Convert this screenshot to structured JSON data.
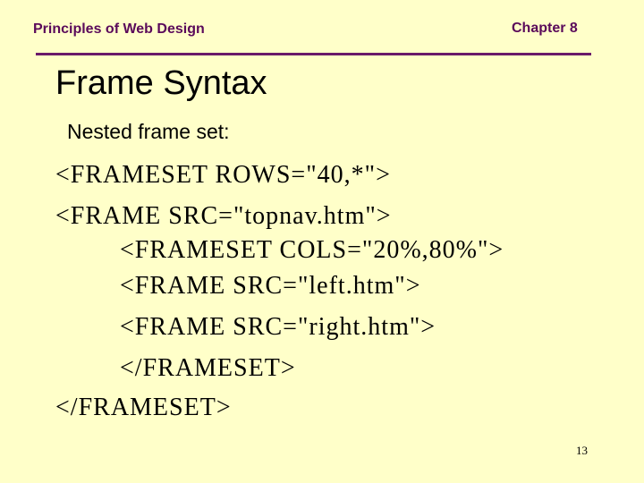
{
  "header": {
    "course": "Principles of Web Design",
    "chapter": "Chapter 8"
  },
  "slide": {
    "title": "Frame Syntax",
    "subtitle": "Nested frame set:",
    "code_lines": [
      "<FRAMESET ROWS=\"40,*\">",
      "<FRAME SRC=\"topnav.htm\">",
      "<FRAMESET COLS=\"20%,80%\">",
      "<FRAME SRC=\"left.htm\">",
      "<FRAME SRC=\"right.htm\">",
      "</FRAMESET>",
      "</FRAMESET>"
    ],
    "page_number": "13"
  }
}
